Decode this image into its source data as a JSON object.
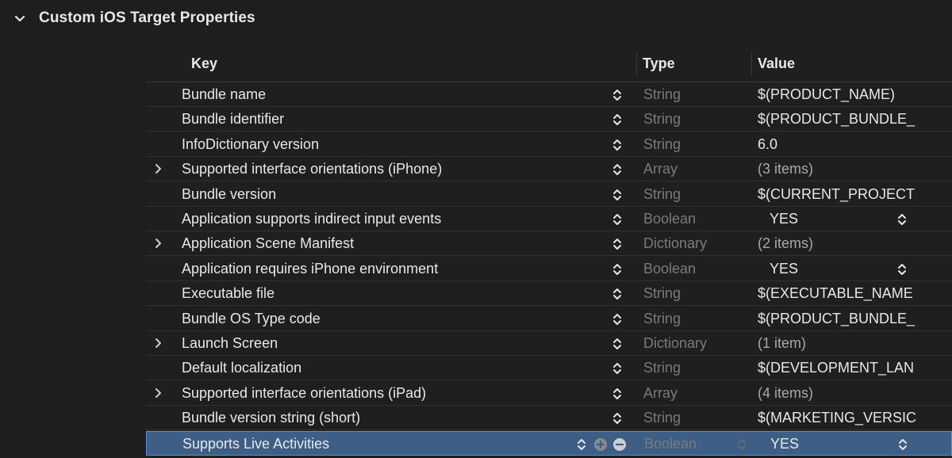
{
  "section": {
    "title": "Custom iOS Target Properties"
  },
  "columns": {
    "key": "Key",
    "type": "Type",
    "value": "Value"
  },
  "rows": [
    {
      "key": "Bundle name",
      "type": "String",
      "value": "$(PRODUCT_NAME)",
      "expandable": false,
      "value_kind": "text"
    },
    {
      "key": "Bundle identifier",
      "type": "String",
      "value": "$(PRODUCT_BUNDLE_",
      "expandable": false,
      "value_kind": "text"
    },
    {
      "key": "InfoDictionary version",
      "type": "String",
      "value": "6.0",
      "expandable": false,
      "value_kind": "text"
    },
    {
      "key": "Supported interface orientations (iPhone)",
      "type": "Array",
      "value": "(3 items)",
      "expandable": true,
      "value_kind": "count"
    },
    {
      "key": "Bundle version",
      "type": "String",
      "value": "$(CURRENT_PROJECT",
      "expandable": false,
      "value_kind": "text"
    },
    {
      "key": "Application supports indirect input events",
      "type": "Boolean",
      "value": "YES",
      "expandable": false,
      "value_kind": "bool"
    },
    {
      "key": "Application Scene Manifest",
      "type": "Dictionary",
      "value": "(2 items)",
      "expandable": true,
      "value_kind": "count"
    },
    {
      "key": "Application requires iPhone environment",
      "type": "Boolean",
      "value": "YES",
      "expandable": false,
      "value_kind": "bool"
    },
    {
      "key": "Executable file",
      "type": "String",
      "value": "$(EXECUTABLE_NAME",
      "expandable": false,
      "value_kind": "text"
    },
    {
      "key": "Bundle OS Type code",
      "type": "String",
      "value": "$(PRODUCT_BUNDLE_",
      "expandable": false,
      "value_kind": "text"
    },
    {
      "key": "Launch Screen",
      "type": "Dictionary",
      "value": "(1 item)",
      "expandable": true,
      "value_kind": "count"
    },
    {
      "key": "Default localization",
      "type": "String",
      "value": "$(DEVELOPMENT_LAN",
      "expandable": false,
      "value_kind": "text"
    },
    {
      "key": "Supported interface orientations (iPad)",
      "type": "Array",
      "value": "(4 items)",
      "expandable": true,
      "value_kind": "count"
    },
    {
      "key": "Bundle version string (short)",
      "type": "String",
      "value": "$(MARKETING_VERSIC",
      "expandable": false,
      "value_kind": "text"
    },
    {
      "key": "Supports Live Activities",
      "type": "Boolean",
      "value": "YES",
      "expandable": false,
      "value_kind": "bool",
      "selected": true
    }
  ],
  "icons": {
    "section_disclosure": "chevron-down-icon",
    "row_expander": "chevron-right-icon",
    "stepper": "up-down-stepper-icon",
    "add": "plus-circle-icon",
    "remove": "minus-circle-icon"
  },
  "colors": {
    "background": "#1e1e1e",
    "selection": "#3d5e85",
    "selection_border": "#5c8fd6",
    "type_text": "#7a7a7a"
  }
}
